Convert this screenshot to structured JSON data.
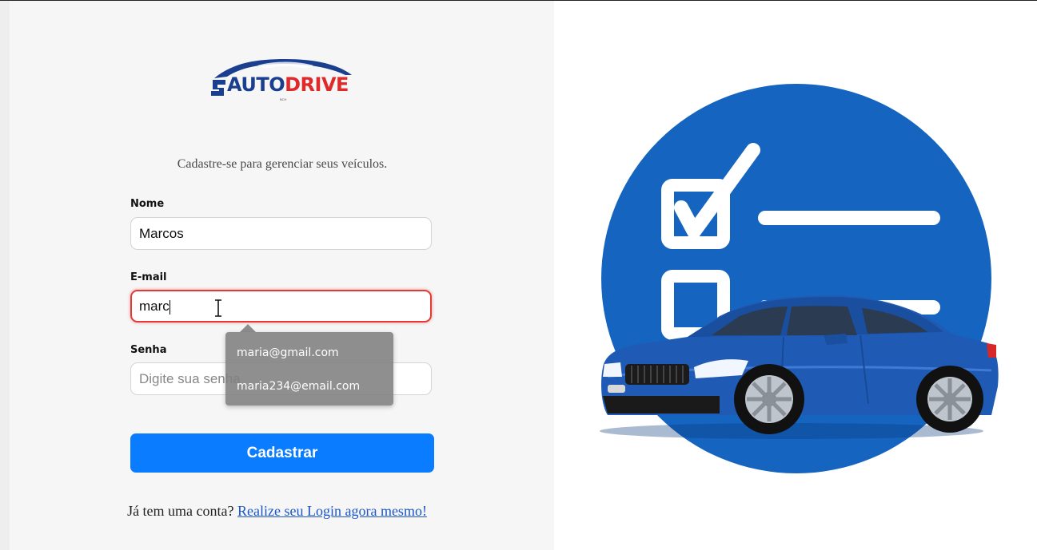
{
  "brand": {
    "name_part1": "AUTO",
    "name_part2": "DRIVE",
    "tagline": "BCH"
  },
  "subtitle": "Cadastre-se para gerenciar seus veículos.",
  "form": {
    "name": {
      "label": "Nome",
      "value": "Marcos"
    },
    "email": {
      "label": "E-mail",
      "value": "marc"
    },
    "password": {
      "label": "Senha",
      "placeholder": "Digite sua senha"
    },
    "submit_label": "Cadastrar"
  },
  "autocomplete": {
    "options": [
      "maria@gmail.com",
      "maria234@email.com"
    ]
  },
  "footer": {
    "text": "Já tem uma conta?",
    "link_label": "Realize seu Login agora mesmo!"
  },
  "colors": {
    "primary_button": "#0a7cff",
    "error_border": "#e53935",
    "illustration_circle": "#1565c0",
    "car_body": "#1f5bb5",
    "brand_blue": "#1a3f8f",
    "brand_red": "#e02a2a"
  },
  "icons": [
    "checklist-icon",
    "checkbox-checked-icon",
    "car-illustration",
    "text-cursor-icon"
  ]
}
